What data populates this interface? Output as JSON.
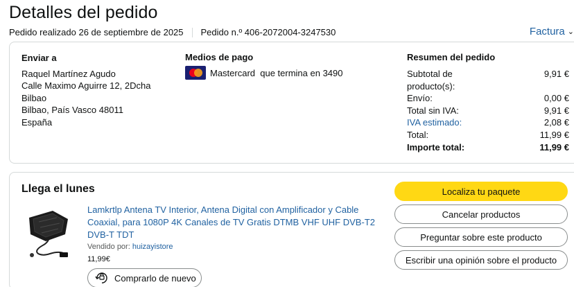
{
  "header": {
    "title": "Detalles del pedido",
    "order_date": "Pedido realizado 26 de septiembre de 2025",
    "order_number": "Pedido n.º 406-2072004-3247530",
    "invoice_label": "Factura"
  },
  "shipping": {
    "title": "Enviar a",
    "lines": [
      "Raquel Martínez Agudo",
      "Calle Maximo Aguirre 12, 2Dcha",
      "Bilbao",
      "Bilbao, País Vasco 48011",
      "España"
    ]
  },
  "payment": {
    "title": "Medios de pago",
    "method": "Mastercard  que termina en 3490",
    "card_icon": "mastercard-icon",
    "card_text": "MasterCard"
  },
  "summary": {
    "title": "Resumen del pedido",
    "rows": [
      {
        "label": "Subtotal de producto(s):",
        "value": "9,91 €"
      },
      {
        "label": "Envío:",
        "value": "0,00 €"
      },
      {
        "label": "Total sin IVA:",
        "value": "9,91 €"
      },
      {
        "label": "IVA estimado:",
        "value": "2,08 €"
      },
      {
        "label": "Total:",
        "value": "11,99 €"
      },
      {
        "label": "Importe total:",
        "value": "11,99 €"
      }
    ]
  },
  "shipment": {
    "arrival": "Llega el lunes",
    "product_title": "Lamkrtlp Antena TV Interior, Antena Digital con Amplificador y Cable Coaxial, para 1080P 4K Canales de TV Gratis DTMB VHF UHF DVB-T2 DVB-T TDT",
    "sold_by_label": "Vendido por: ",
    "seller": "huizayistore",
    "price": "11,99€",
    "buy_again": "Comprarlo de nuevo",
    "actions": [
      "Localiza tu paquete",
      "Cancelar productos",
      "Preguntar sobre este producto",
      "Escribir una opinión sobre el producto"
    ]
  },
  "colors": {
    "link": "#2162a1",
    "primary_button": "#ffd814",
    "border": "#d5d9d9"
  }
}
